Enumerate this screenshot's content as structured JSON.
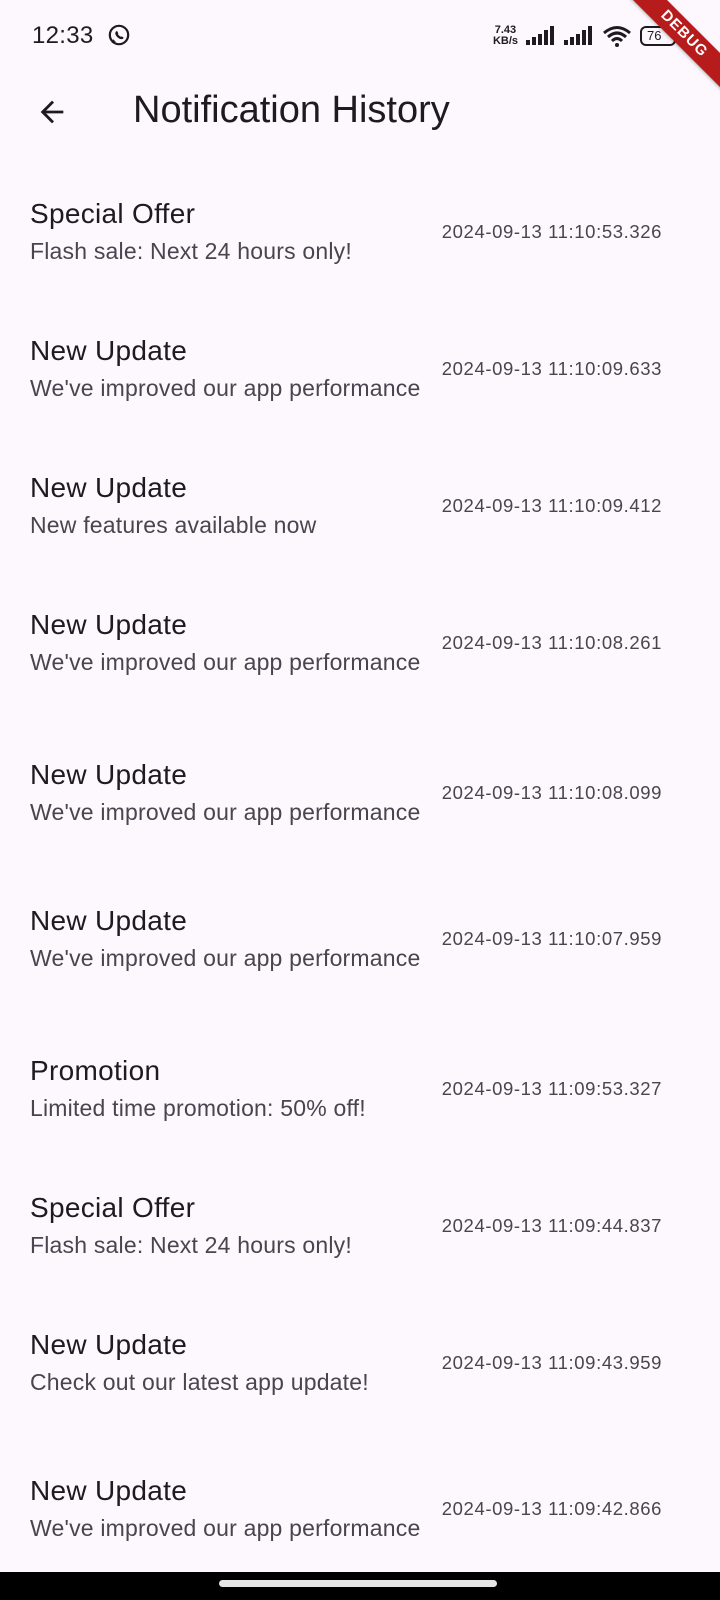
{
  "status_bar": {
    "time": "12:33",
    "net_speed_value": "7.43",
    "net_speed_unit": "KB/s",
    "battery": "76"
  },
  "debug_banner": "DEBUG",
  "app_bar": {
    "title": "Notification History"
  },
  "notifications": [
    {
      "title": "Special Offer",
      "body": "Flash sale: Next 24 hours only!",
      "timestamp": "2024-09-13 11:10:53.326"
    },
    {
      "title": "New Update",
      "body": "We've improved our app performance",
      "timestamp": "2024-09-13 11:10:09.633"
    },
    {
      "title": "New Update",
      "body": "New features available now",
      "timestamp": "2024-09-13 11:10:09.412"
    },
    {
      "title": "New Update",
      "body": "We've improved our app performance",
      "timestamp": "2024-09-13 11:10:08.261"
    },
    {
      "title": "New Update",
      "body": "We've improved our app performance",
      "timestamp": "2024-09-13 11:10:08.099"
    },
    {
      "title": "New Update",
      "body": "We've improved our app performance",
      "timestamp": "2024-09-13 11:10:07.959"
    },
    {
      "title": "Promotion",
      "body": "Limited time promotion: 50% off!",
      "timestamp": "2024-09-13 11:09:53.327"
    },
    {
      "title": "Special Offer",
      "body": "Flash sale: Next 24 hours only!",
      "timestamp": "2024-09-13 11:09:44.837"
    },
    {
      "title": "New Update",
      "body": "Check out our latest app update!",
      "timestamp": "2024-09-13 11:09:43.959"
    },
    {
      "title": "New Update",
      "body": "We've improved our app performance",
      "timestamp": "2024-09-13 11:09:42.866"
    }
  ],
  "icons": {
    "back": "arrow-back-icon",
    "status_app": "whatsapp-icon",
    "signal": "signal-icon",
    "wifi": "wifi-icon",
    "battery": "battery-icon"
  },
  "colors": {
    "background": "#fdf7fe",
    "title_text": "#1d1b20",
    "secondary_text": "#49454f",
    "debug_ribbon": "#b71c1c"
  }
}
